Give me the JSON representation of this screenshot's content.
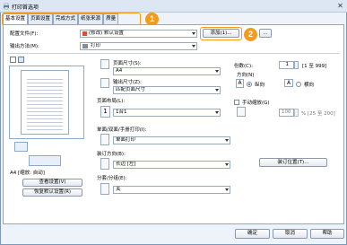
{
  "window": {
    "title": "打印首选项",
    "close_glyph": "✕"
  },
  "tabs": [
    {
      "label": "基本设置"
    },
    {
      "label": "页面设置"
    },
    {
      "label": "完成方式"
    },
    {
      "label": "纸张来源"
    },
    {
      "label": "质量"
    }
  ],
  "badges": {
    "one": "1",
    "two": "2"
  },
  "profile": {
    "label": "配置文件(F):",
    "value": "(修改) 默认设置",
    "add_button": "添加(1)...",
    "edit_button": "..."
  },
  "output": {
    "label": "输出方法(M):",
    "value": "打印"
  },
  "page_size": {
    "label": "页面尺寸(S):",
    "value": "A4"
  },
  "output_size": {
    "label": "输出尺寸(Z):",
    "value": "匹配页面尺寸"
  },
  "copies": {
    "label": "份数(C):",
    "value": "1",
    "range": "[1 至 999]"
  },
  "orientation": {
    "label": "方向(N)",
    "portrait_label": "纵向",
    "landscape_label": "横向",
    "portrait_icon": "A",
    "landscape_icon": "A"
  },
  "page_layout": {
    "label": "页面布局(L):",
    "value": "1合1",
    "icon_text": "1"
  },
  "manual_scaling": {
    "label": "手动缩放(G)",
    "value": "100",
    "range": "% [25 至 200]"
  },
  "duplex": {
    "label": "单面/双面/手册打印(I):",
    "value": "单面打印"
  },
  "binding": {
    "label": "装订方向(B):",
    "value": "长边 [左]",
    "button": "装订位置(T)..."
  },
  "collate": {
    "label": "分套/分组(E):",
    "value": "关"
  },
  "preview": {
    "caption": "A4 [缩放: 自动]",
    "settings_button": "查看设置(V)",
    "restore_button": "恢复默认设置(R)"
  },
  "footer": {
    "ok": "确定",
    "cancel": "取消",
    "help": "帮助"
  }
}
